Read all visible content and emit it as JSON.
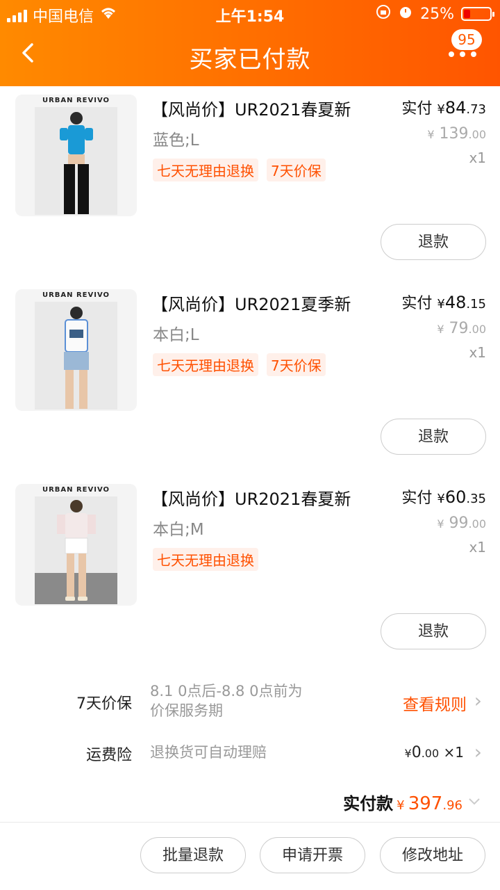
{
  "status_bar": {
    "carrier": "中国电信",
    "time": "上午1:54",
    "battery": "25%"
  },
  "nav": {
    "back_icon": "chevron-left-icon",
    "title": "买家已付款",
    "badge": "95",
    "more_icon": "more-dots-icon"
  },
  "products": [
    {
      "brand": "URBAN REVIVO",
      "title": "【风尚价】UR2021春夏新",
      "spec": "蓝色;L",
      "tags": [
        "七天无理由退换",
        "7天价保"
      ],
      "paid_label": "实付",
      "currency": "¥",
      "paid_int": "84",
      "paid_dec": ".73",
      "orig_int": "139",
      "orig_dec": ".00",
      "qty": "x1",
      "refund": "退款"
    },
    {
      "brand": "URBAN REVIVO",
      "title": "【风尚价】UR2021夏季新",
      "spec": "本白;L",
      "tags": [
        "七天无理由退换",
        "7天价保"
      ],
      "paid_label": "实付",
      "currency": "¥",
      "paid_int": "48",
      "paid_dec": ".15",
      "orig_int": "79",
      "orig_dec": ".00",
      "qty": "x1",
      "refund": "退款"
    },
    {
      "brand": "URBAN REVIVO",
      "title": "【风尚价】UR2021春夏新",
      "spec": "本白;M",
      "tags": [
        "七天无理由退换"
      ],
      "paid_label": "实付",
      "currency": "¥",
      "paid_int": "60",
      "paid_dec": ".35",
      "orig_int": "99",
      "orig_dec": ".00",
      "qty": "x1",
      "refund": "退款"
    }
  ],
  "price_protection": {
    "label": "7天价保",
    "desc_line1": "8.1 0点后-8.8 0点前为",
    "desc_line2": "价保服务期",
    "action": "查看规则"
  },
  "shipping_insurance": {
    "label": "运费险",
    "desc": "退换货可自动理赔",
    "currency": "¥",
    "fee_int": "0",
    "fee_dec": ".00",
    "qty": "×1"
  },
  "total": {
    "label": "实付款",
    "currency": "¥",
    "int": "397",
    "dec": ".96"
  },
  "bottom_actions": {
    "batch_refund": "批量退款",
    "invoice": "申请开票",
    "edit_address": "修改地址"
  }
}
